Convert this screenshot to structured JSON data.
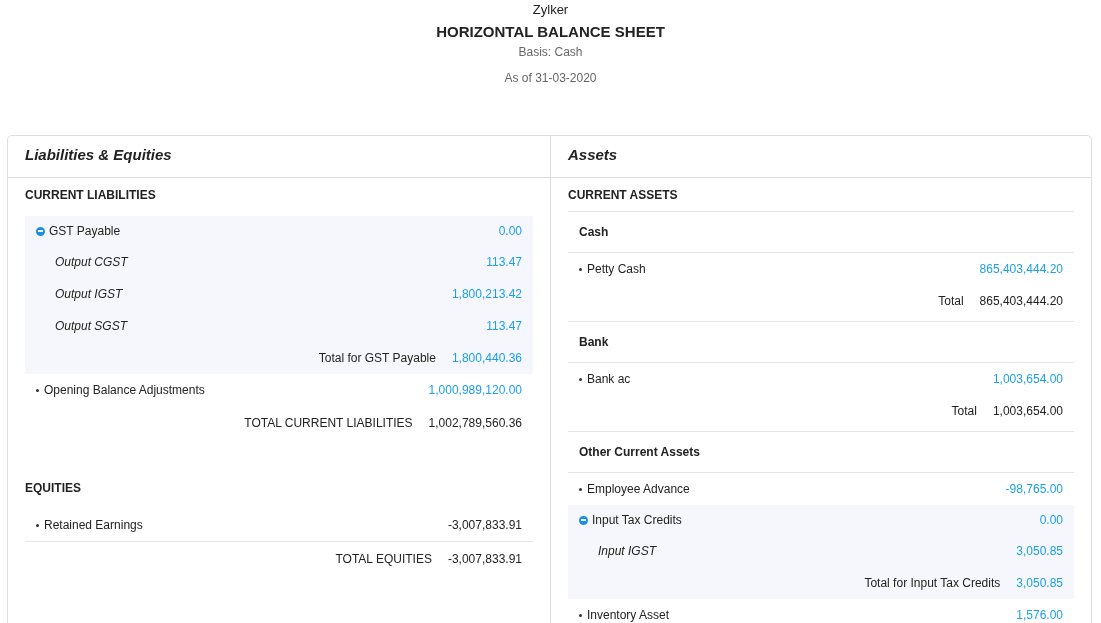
{
  "report": {
    "company": "Zylker",
    "title": "HORIZONTAL BALANCE SHEET",
    "basis": "Basis: Cash",
    "as_of": "As of 31-03-2020"
  },
  "columns": [
    {
      "title": "Liabilities & Equities",
      "sections": [
        {
          "heading": "CURRENT LIABILITIES",
          "rows": [
            {
              "kind": "group",
              "label": "GST Payable",
              "amount": "0.00",
              "expanded": true,
              "children": [
                {
                  "label": "Output CGST",
                  "amount": "113.47"
                },
                {
                  "label": "Output IGST",
                  "amount": "1,800,213.42"
                },
                {
                  "label": "Output SGST",
                  "amount": "113.47"
                }
              ],
              "total": {
                "label": "Total for GST Payable",
                "amount": "1,800,440.36"
              }
            },
            {
              "kind": "account",
              "label": "Opening Balance Adjustments",
              "amount": "1,000,989,120.00",
              "linked": true
            }
          ],
          "total": {
            "label": "TOTAL CURRENT LIABILITIES",
            "amount": "1,002,789,560.36"
          }
        },
        {
          "heading": "EQUITIES",
          "rows": [
            {
              "kind": "account",
              "label": "Retained Earnings",
              "amount": "-3,007,833.91",
              "linked": false
            }
          ],
          "total": {
            "label": "TOTAL EQUITIES",
            "amount": "-3,007,833.91"
          }
        }
      ]
    },
    {
      "title": "Assets",
      "sections": [
        {
          "heading": "CURRENT ASSETS",
          "rows": [
            {
              "kind": "subheading",
              "label": "Cash"
            },
            {
              "kind": "account",
              "label": "Petty Cash",
              "amount": "865,403,444.20",
              "linked": true
            },
            {
              "kind": "subtotal",
              "label": "Total",
              "amount": "865,403,444.20"
            },
            {
              "kind": "subheading",
              "label": "Bank"
            },
            {
              "kind": "account",
              "label": "Bank ac",
              "amount": "1,003,654.00",
              "linked": true
            },
            {
              "kind": "subtotal",
              "label": "Total",
              "amount": "1,003,654.00"
            },
            {
              "kind": "subheading",
              "label": "Other Current Assets"
            },
            {
              "kind": "account",
              "label": "Employee Advance",
              "amount": "-98,765.00",
              "linked": true
            },
            {
              "kind": "group",
              "label": "Input Tax Credits",
              "amount": "0.00",
              "expanded": true,
              "children": [
                {
                  "label": "Input IGST",
                  "amount": "3,050.85"
                }
              ],
              "total": {
                "label": "Total for Input Tax Credits",
                "amount": "3,050.85"
              }
            },
            {
              "kind": "account",
              "label": "Inventory Asset",
              "amount": "1,576.00",
              "linked": true
            }
          ]
        }
      ]
    }
  ]
}
